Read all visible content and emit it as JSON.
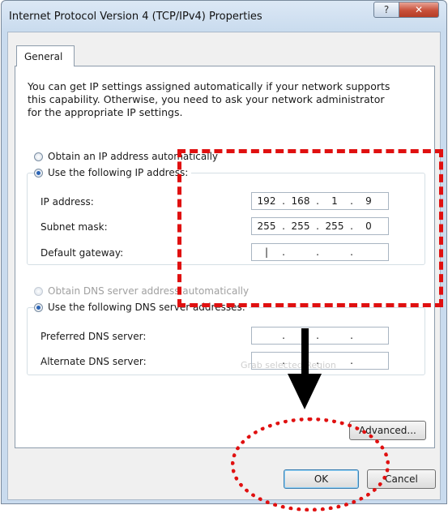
{
  "window": {
    "title": "Internet Protocol Version 4 (TCP/IPv4) Properties",
    "help_glyph": "?",
    "close_glyph": "✕"
  },
  "tabs": [
    {
      "label": "General",
      "selected": true
    }
  ],
  "description": "You can get IP settings assigned automatically if your network supports\nthis capability. Otherwise, you need to ask your network administrator\nfor the appropriate IP settings.",
  "ip_section": {
    "auto_option": {
      "label": "Obtain an IP address automatically",
      "checked": false
    },
    "manual_option": {
      "label": "Use the following IP address:",
      "checked": true
    },
    "fields": [
      {
        "label": "IP address:",
        "octets": [
          "192",
          "168",
          "1",
          "9"
        ]
      },
      {
        "label": "Subnet mask:",
        "octets": [
          "255",
          "255",
          "255",
          "0"
        ]
      },
      {
        "label": "Default gateway:",
        "octets": [
          "|",
          "",
          "",
          ""
        ]
      }
    ]
  },
  "dns_section": {
    "auto_option": {
      "label": "Obtain DNS server address automatically",
      "checked": false,
      "disabled": true
    },
    "manual_option": {
      "label": "Use the following DNS server addresses:",
      "checked": true
    },
    "fields": [
      {
        "label": "Preferred DNS server:",
        "octets": [
          "",
          "",
          "",
          ""
        ]
      },
      {
        "label": "Alternate DNS server:",
        "octets": [
          "",
          "",
          "",
          ""
        ]
      }
    ]
  },
  "ghost_text": "Grab selected Region",
  "buttons": {
    "advanced": "Advanced...",
    "ok": "OK",
    "cancel": "Cancel"
  },
  "annotation_color": "#e01010",
  "arrow_color": "#000000"
}
